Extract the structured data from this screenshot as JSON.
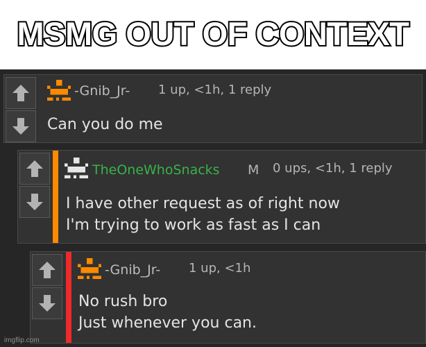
{
  "meme_title": "MSMG OUT OF CONTEXT",
  "colors": {
    "accent_orange": "#ff8a00",
    "accent_red": "#ee2a2a",
    "username_green": "#38b24a",
    "username_gray": "#bdbdbd"
  },
  "comments": [
    {
      "username": "-Gnib_Jr-",
      "badge": "",
      "meta": "1 up, <1h, 1 reply",
      "body": [
        "Can you do me"
      ],
      "avatar_icon": "orange-pixel-avatar-icon"
    },
    {
      "username": "TheOneWhoSnacks",
      "badge": "M",
      "meta": "0 ups, <1h, 1 reply",
      "body": [
        "I have other request as of right now",
        "I'm trying to work as fast as I can"
      ],
      "avatar_icon": "white-pixel-avatar-icon"
    },
    {
      "username": "-Gnib_Jr-",
      "badge": "",
      "meta": "1 up, <1h",
      "body": [
        "No rush bro",
        "Just whenever you can."
      ],
      "avatar_icon": "orange-pixel-avatar-icon"
    }
  ],
  "watermark": "imgflip.com"
}
